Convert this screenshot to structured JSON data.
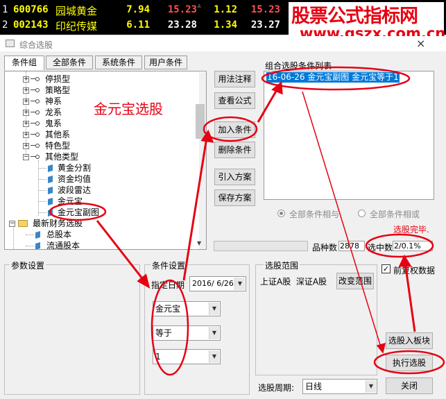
{
  "ticker": [
    {
      "index": "1",
      "code": "600766",
      "name": "园城黄金",
      "price": "7.94",
      "col1": "15.23",
      "col2": "1.12",
      "col3": "15.23"
    },
    {
      "index": "2",
      "code": "002143",
      "name": "印纪传媒",
      "price": "6.11",
      "col1": "23.28",
      "col2": "1.34",
      "col3": "23.27"
    }
  ],
  "watermark": {
    "title": "股票公式指标网",
    "url": "www.gszx.com.cn"
  },
  "window": {
    "title": "综合选股",
    "close": "×"
  },
  "tabs": [
    "条件组",
    "全部条件",
    "系统条件",
    "用户条件"
  ],
  "tree": {
    "items": [
      "停损型",
      "策略型",
      "神系",
      "龙系",
      "鬼系",
      "其他系",
      "特色型",
      "其他类型",
      "黄金分割",
      "资金均值",
      "波段雷达",
      "金元宝",
      "金元宝副图",
      "最新财务选股",
      "总股本",
      "流通股本"
    ]
  },
  "buttons": {
    "usage_notes": "用法注释",
    "view_formula": "查看公式",
    "add_condition": "加入条件",
    "delete_condition": "删除条件",
    "import_plan": "引入方案",
    "save_plan": "保存方案",
    "change_scope": "改变范围",
    "to_block": "选股入板块",
    "run_selection": "执行选股",
    "close": "关闭"
  },
  "condition_list": {
    "label": "组合选股条件列表",
    "items": [
      "16-06-26 金元宝副图 金元宝等于1"
    ]
  },
  "logic": {
    "and": "全部条件相与",
    "or": "全部条件相或"
  },
  "stats": {
    "count_label": "品种数",
    "count_value": "2878",
    "selected_label": "选中数",
    "selected_value": "2/0.1%"
  },
  "params": {
    "label": "参数设置"
  },
  "condition_settings": {
    "label": "条件设置",
    "date_label": "指定日期",
    "date_value": "2016/ 6/26",
    "field": "金元宝",
    "operator": "等于",
    "value": "1"
  },
  "scope": {
    "label": "选股范围",
    "markets": "上证A股  深证A股"
  },
  "prev_restore": {
    "label": "前复权数据",
    "checked": true
  },
  "period": {
    "label": "选股周期:",
    "value": "日线"
  },
  "annotations": {
    "main": "金元宝选股",
    "done": "选股完毕."
  },
  "colors": {
    "annotation": "#e60012",
    "selection": "#0078d7"
  }
}
